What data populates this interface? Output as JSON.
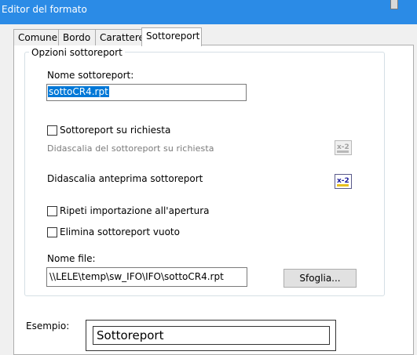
{
  "window": {
    "title": "Editor del formato"
  },
  "tabs": [
    {
      "label": "Comune",
      "active": false
    },
    {
      "label": "Bordo",
      "active": false
    },
    {
      "label": "Carattere",
      "active": false
    },
    {
      "label": "Sottoreport",
      "active": true
    }
  ],
  "options_group": {
    "legend": "Opzioni sottoreport",
    "name_label": "Nome sottoreport:",
    "name_value": "sottoCR4.rpt",
    "on_demand": {
      "label": "Sottoreport su richiesta",
      "checked": false
    },
    "on_demand_caption": {
      "label": "Didascalia del sottoreport su richiesta",
      "enabled": false,
      "icon": "formula-x2-icon"
    },
    "preview_caption": {
      "label": "Didascalia anteprima sottoreport",
      "enabled": true,
      "icon": "formula-x2-icon"
    },
    "reimport": {
      "label": "Ripeti importazione all'apertura",
      "checked": false
    },
    "suppress_blank": {
      "label": "Elimina sottoreport vuoto",
      "checked": false
    },
    "file_label": "Nome file:",
    "file_value": "\\\\LELE\\temp\\sw_IFO\\IFO\\sottoCR4.rpt",
    "browse_label": "Sfoglia..."
  },
  "example": {
    "label": "Esempio:",
    "preview_text": "Sottoreport"
  }
}
